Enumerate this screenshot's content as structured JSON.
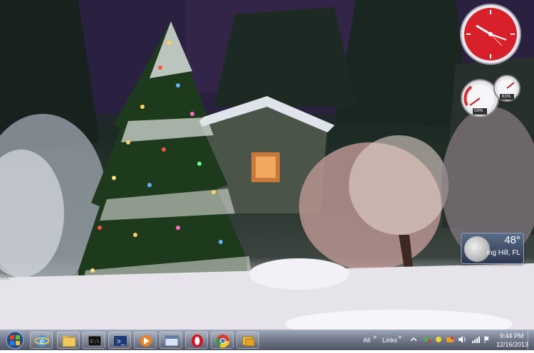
{
  "desktop": {
    "left_label": "Bin"
  },
  "gadgets": {
    "weather": {
      "temperature": "48°",
      "location": "ing Hill, FL"
    },
    "cpu_meter": {
      "cpu_percent": "03%",
      "memory_percent": "61%"
    },
    "clock": {
      "style": "red"
    }
  },
  "taskbar": {
    "pinned": [
      {
        "name": "internet-explorer-icon"
      },
      {
        "name": "windows-explorer-icon"
      },
      {
        "name": "command-prompt-icon"
      },
      {
        "name": "powershell-icon"
      },
      {
        "name": "media-player-icon"
      },
      {
        "name": "window-app-icon"
      },
      {
        "name": "opera-icon"
      },
      {
        "name": "chrome-icon"
      },
      {
        "name": "folder-app-icon"
      }
    ],
    "toolbar_all": "All",
    "toolbar_links": "Links",
    "chevron": "»",
    "time": "9:44 PM",
    "date": "12/16/2013"
  },
  "colors": {
    "clock_red": "#d8202a",
    "taskbar": "#5a6478"
  }
}
